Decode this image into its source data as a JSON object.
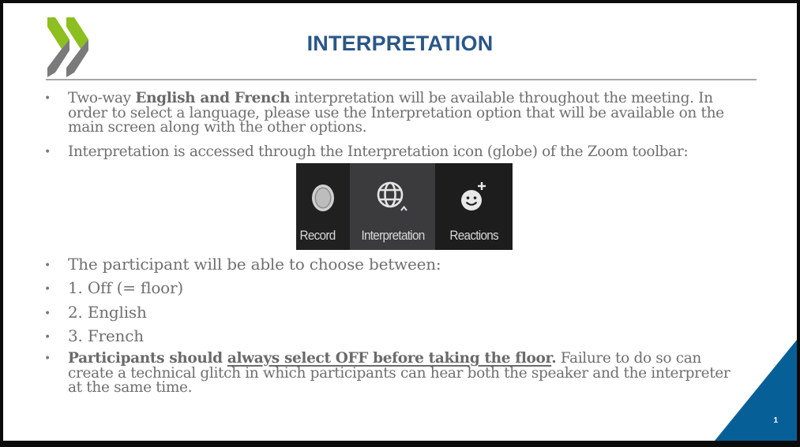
{
  "slide": {
    "title": "INTERPRETATION",
    "page_number": "1",
    "colors": {
      "title": "#2a5687",
      "logo_green": "#8cbf1f",
      "logo_gray": "#7a7a7a",
      "corner_blue": "#075f98",
      "body_text": "#6f6f6f"
    },
    "logo": {
      "icon": "oecd-chevrons-logo"
    },
    "bullets": [
      {
        "prefix": "Two-way ",
        "bold": "English and French",
        "suffix": " interpretation will be available throughout the meeting. In order to select a language, please use the Interpretation option that will be available on the main screen along with the other options."
      },
      {
        "text": "Interpretation is accessed through the Interpretation icon (globe) of the Zoom toolbar:"
      },
      {
        "text": "The participant will be able to choose between:"
      },
      {
        "text": "1. Off (= floor)"
      },
      {
        "text": "2. English"
      },
      {
        "text": "3. French"
      },
      {
        "bold_prefix": "Participants should ",
        "bold_underlined": "always select OFF before taking the floor",
        "bold_period": ".",
        "suffix": " Failure to do so can create a technical glitch in which participants can hear both the speaker and the interpreter at the same time."
      }
    ],
    "toolbar": {
      "items": [
        {
          "label": "Record",
          "icon": "record-icon"
        },
        {
          "label": "Interpretation",
          "icon": "globe-icon",
          "has_caret": true
        },
        {
          "label": "Reactions",
          "icon": "smiley-plus-icon"
        }
      ]
    }
  }
}
